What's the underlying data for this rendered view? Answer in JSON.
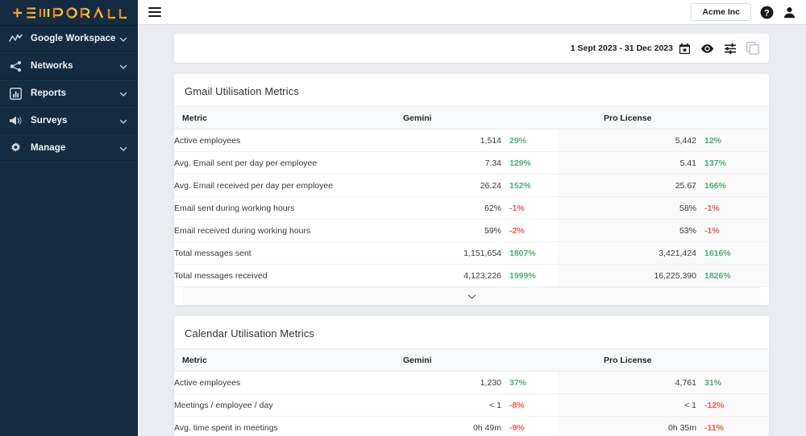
{
  "brand": {
    "logo_text": "TEMPORALL",
    "logo_color_start": "#f07d28",
    "logo_color_end": "#ffd23f",
    "sidebar_bg": "#132c41"
  },
  "sidebar": {
    "items": [
      {
        "label": "Google Workspace",
        "icon": "trend-line-icon",
        "chevron": "chevron-down-icon"
      },
      {
        "label": "Networks",
        "icon": "share-nodes-icon",
        "chevron": "chevron-down-icon"
      },
      {
        "label": "Reports",
        "icon": "bar-chart-icon",
        "chevron": "chevron-down-icon"
      },
      {
        "label": "Surveys",
        "icon": "megaphone-icon",
        "chevron": "chevron-down-icon"
      },
      {
        "label": "Manage",
        "icon": "gear-icon",
        "chevron": "chevron-down-icon"
      }
    ]
  },
  "topbar": {
    "menu_icon": "hamburger-icon",
    "org_button": "Acme Inc",
    "help_icon": "help-circle-icon",
    "account_icon": "user-avatar-icon"
  },
  "filterbar": {
    "date_range": "1 Sept 2023 - 31 Dec 2023",
    "calendar_icon": "calendar-icon",
    "visibility_icon": "eye-icon",
    "settings_icon": "sliders-icon",
    "duplicate_icon": "copy-layers-icon"
  },
  "tables": [
    {
      "title": "Gmail Utilisation Metrics",
      "columns": [
        "Metric",
        "Gemini",
        "Pro License"
      ],
      "has_expander": true,
      "expander_icon": "chevron-down-icon",
      "rows": [
        {
          "metric": "Active employees",
          "gemini_value": "1,514",
          "gemini_pct": "29%",
          "gemini_dir": "up",
          "pro_value": "5,442",
          "pro_pct": "12%",
          "pro_dir": "up"
        },
        {
          "metric": "Avg. Email sent per day per employee",
          "gemini_value": "7.34",
          "gemini_pct": "129%",
          "gemini_dir": "up",
          "pro_value": "5.41",
          "pro_pct": "137%",
          "pro_dir": "up"
        },
        {
          "metric": "Avg. Email received per day per employee",
          "gemini_value": "26.24",
          "gemini_pct": "152%",
          "gemini_dir": "up",
          "pro_value": "25.67",
          "pro_pct": "166%",
          "pro_dir": "up"
        },
        {
          "metric": "Email sent during working hours",
          "gemini_value": "62%",
          "gemini_pct": "-1%",
          "gemini_dir": "down",
          "pro_value": "58%",
          "pro_pct": "-1%",
          "pro_dir": "down"
        },
        {
          "metric": "Email received during working hours",
          "gemini_value": "59%",
          "gemini_pct": "-2%",
          "gemini_dir": "down",
          "pro_value": "53%",
          "pro_pct": "-1%",
          "pro_dir": "down"
        },
        {
          "metric": "Total messages sent",
          "gemini_value": "1,151,654",
          "gemini_pct": "1807%",
          "gemini_dir": "up",
          "pro_value": "3,421,424",
          "pro_pct": "1616%",
          "pro_dir": "up"
        },
        {
          "metric": "Total messages received",
          "gemini_value": "4,123,226",
          "gemini_pct": "1999%",
          "gemini_dir": "up",
          "pro_value": "16,225,390",
          "pro_pct": "1826%",
          "pro_dir": "up"
        }
      ]
    },
    {
      "title": "Calendar Utilisation Metrics",
      "columns": [
        "Metric",
        "Gemini",
        "Pro License"
      ],
      "has_expander": false,
      "expander_icon": "chevron-down-icon",
      "rows": [
        {
          "metric": "Active employees",
          "gemini_value": "1,230",
          "gemini_pct": "37%",
          "gemini_dir": "up",
          "pro_value": "4,761",
          "pro_pct": "31%",
          "pro_dir": "up"
        },
        {
          "metric": "Meetings / employee / day",
          "gemini_value": "< 1",
          "gemini_pct": "-8%",
          "gemini_dir": "down",
          "pro_value": "< 1",
          "pro_pct": "-12%",
          "pro_dir": "down"
        },
        {
          "metric": "Avg. time spent in meetings",
          "gemini_value": "0h 49m",
          "gemini_pct": "-9%",
          "gemini_dir": "down",
          "pro_value": "0h 35m",
          "pro_pct": "-11%",
          "pro_dir": "down"
        }
      ]
    }
  ],
  "colors": {
    "positive": "#4caf72",
    "negative": "#f2584e",
    "page_bg": "#eaecf2"
  }
}
